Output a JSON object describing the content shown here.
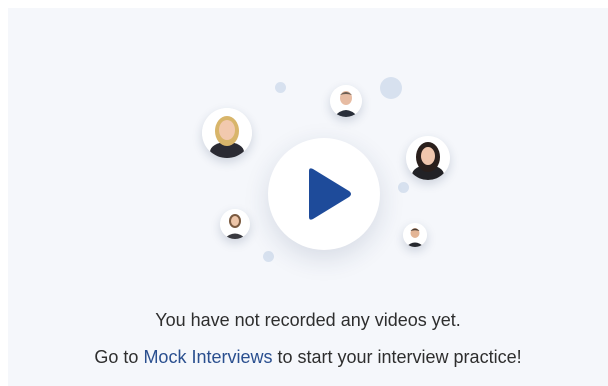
{
  "empty_state": {
    "message": "You have not recorded any videos yet.",
    "cta_prefix": "Go to ",
    "cta_link": "Mock Interviews",
    "cta_suffix": " to start your interview practice!"
  },
  "illustration": {
    "play_icon": "play-triangle-icon",
    "avatars": [
      "avatar-woman-blonde",
      "avatar-man-suit",
      "avatar-woman-dark-hair",
      "avatar-woman-small",
      "avatar-man-small"
    ]
  },
  "colors": {
    "background": "#f5f7fb",
    "accent": "#1e4b9a",
    "link": "#2a4f8f",
    "text": "#2e2e2e",
    "decor": "#d7e1ef"
  }
}
